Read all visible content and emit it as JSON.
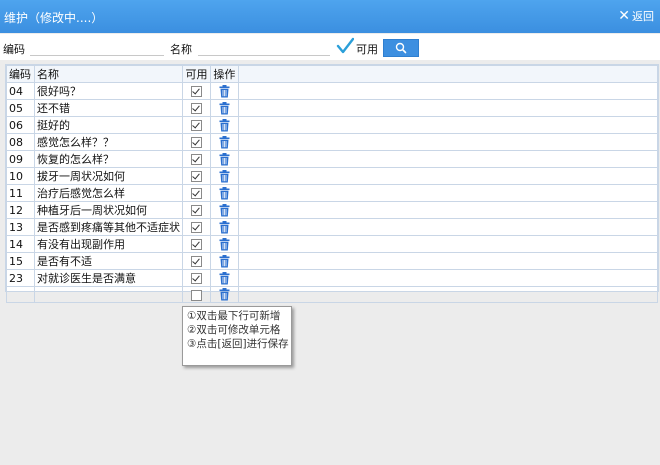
{
  "window": {
    "title": "维护（修改中....）",
    "back_label": "返回"
  },
  "filter": {
    "code_label": "编码",
    "code_value": "",
    "name_label": "名称",
    "name_value": "",
    "enabled_label": "可用",
    "enabled_checked": true
  },
  "table": {
    "headers": {
      "code": "编码",
      "name": "名称",
      "enabled": "可用",
      "action": "操作"
    },
    "rows": [
      {
        "code": "04",
        "name": "很好吗？",
        "enabled": true
      },
      {
        "code": "05",
        "name": "还不错",
        "enabled": true
      },
      {
        "code": "06",
        "name": "挺好的",
        "enabled": true
      },
      {
        "code": "08",
        "name": "感觉怎么样？？",
        "enabled": true
      },
      {
        "code": "09",
        "name": "恢复的怎么样？",
        "enabled": true
      },
      {
        "code": "10",
        "name": "拔牙一周状况如何",
        "enabled": true
      },
      {
        "code": "11",
        "name": "治疗后感觉怎么样",
        "enabled": true
      },
      {
        "code": "12",
        "name": "种植牙后一周状况如何",
        "enabled": true
      },
      {
        "code": "13",
        "name": "是否感到疼痛等其他不适症状",
        "enabled": true
      },
      {
        "code": "14",
        "name": "有没有出现副作用",
        "enabled": true
      },
      {
        "code": "15",
        "name": "是否有不适",
        "enabled": true
      },
      {
        "code": "23",
        "name": "对就诊医生是否满意",
        "enabled": true
      },
      {
        "code": "",
        "name": "",
        "enabled": false
      }
    ]
  },
  "tips": [
    "①双击最下行可新增",
    "②双击可修改单元格",
    "③点击[返回]进行保存"
  ],
  "colors": {
    "titlebar": "#3d92e2",
    "accent": "#3d8fe0",
    "trash": "#2a6fcf"
  }
}
